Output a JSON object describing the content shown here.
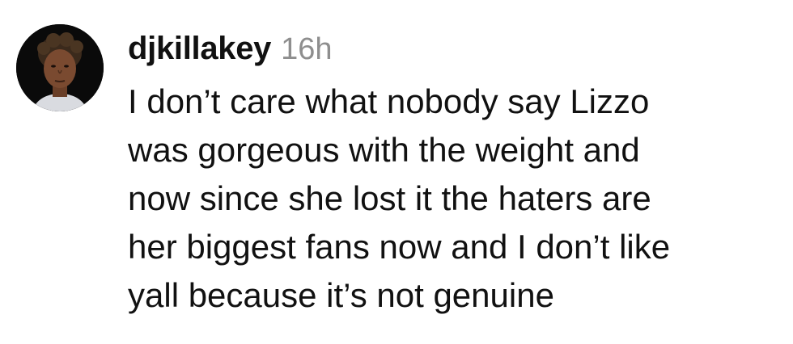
{
  "comment": {
    "username": "djkillakey",
    "timestamp": "16h",
    "text_lines": [
      "I don’t care what nobody say Lizzo",
      "was gorgeous with the weight and",
      "now since she lost it the haters are",
      "her biggest fans now and I don’t like",
      "yall because it’s not genuine"
    ]
  },
  "colors": {
    "background": "#ffffff",
    "text": "#111111",
    "timestamp": "#8e8e8e"
  }
}
